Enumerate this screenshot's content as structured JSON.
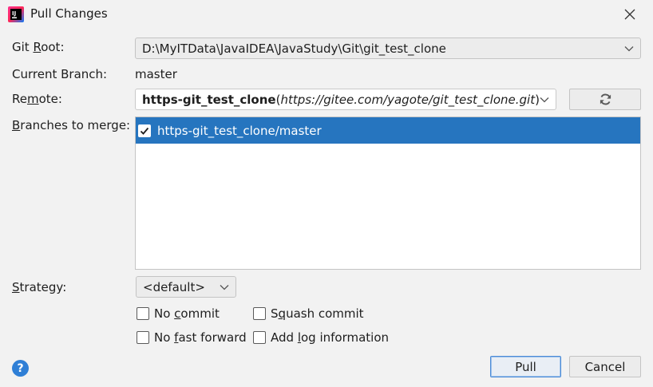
{
  "window": {
    "title": "Pull Changes",
    "icon": "intellij-idea-icon"
  },
  "form": {
    "git_root_label_pre": "Git ",
    "git_root_label_mnemonic": "R",
    "git_root_label_post": "oot:",
    "git_root_value": "D:\\MyITData\\JavaIDEA\\JavaStudy\\Git\\git_test_clone",
    "current_branch_label": "Current Branch:",
    "current_branch_value": "master",
    "remote_label_pre": "Re",
    "remote_label_mnemonic": "m",
    "remote_label_post": "ote:",
    "remote_name": "https-git_test_clone",
    "remote_paren_open": "(",
    "remote_url": "https://gitee.com/yagote/git_test_clone.git",
    "remote_paren_close": ")",
    "branches_label_mnemonic": "B",
    "branches_label_post": "ranches to merge:",
    "branches": [
      {
        "name": "https-git_test_clone/master",
        "checked": true
      }
    ],
    "strategy_label_mnemonic": "S",
    "strategy_label_post": "trategy:",
    "strategy_value": "<default>"
  },
  "options": {
    "no_commit_pre": "No ",
    "no_commit_mnemonic": "c",
    "no_commit_post": "ommit",
    "squash_pre": "S",
    "squash_mnemonic": "q",
    "squash_post": "uash commit",
    "no_ff_pre": "No ",
    "no_ff_mnemonic": "f",
    "no_ff_post": "ast forward",
    "add_log_pre": "Add ",
    "add_log_mnemonic": "l",
    "add_log_post": "og information"
  },
  "buttons": {
    "pull": "Pull",
    "cancel": "Cancel",
    "help": "?"
  },
  "colors": {
    "selection": "#2675bf",
    "help": "#2f7fd6",
    "default_button_border": "#4a8bd8"
  }
}
